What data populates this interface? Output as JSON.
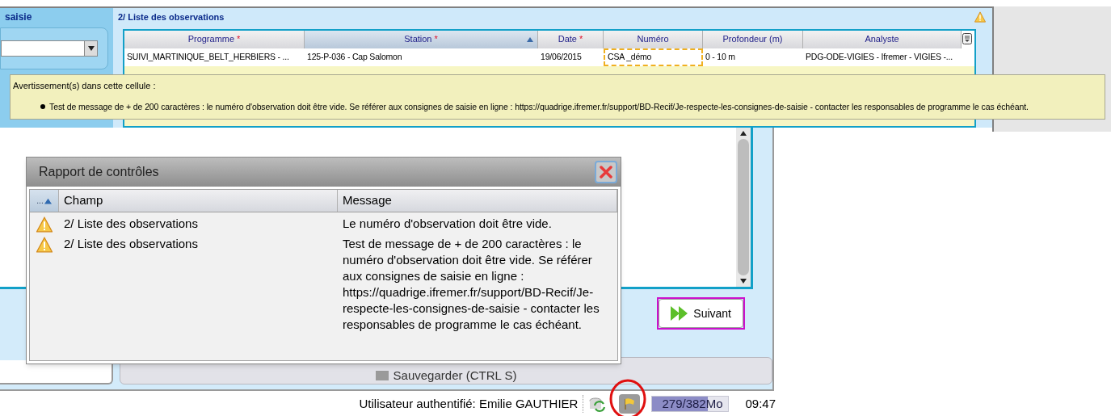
{
  "left_panel": {
    "title": "saisie"
  },
  "observations": {
    "title": "2/ Liste des observations",
    "required_mark": "*",
    "columns": [
      {
        "label": "Programme",
        "required": true,
        "sorted": false
      },
      {
        "label": "Station",
        "required": true,
        "sorted": true
      },
      {
        "label": "Date",
        "required": true,
        "sorted": false
      },
      {
        "label": "Numéro",
        "required": false,
        "sorted": false
      },
      {
        "label": "Profondeur (m)",
        "required": false,
        "sorted": false
      },
      {
        "label": "Analyste",
        "required": false,
        "sorted": false
      }
    ],
    "rows": [
      {
        "cells": [
          {
            "text": "SUIVI_MARTINIQUE_BELT_HERBIERS - ...",
            "warning": false
          },
          {
            "text": "125-P-036 - Cap Salomon",
            "warning": false
          },
          {
            "text": "19/06/2015",
            "warning": false
          },
          {
            "text": "CSA _démo",
            "warning": true
          },
          {
            "text": "0 - 10 m",
            "warning": false
          },
          {
            "text": "PDG-ODE-VIGIES - Ifremer - VIGIES -...",
            "warning": false
          }
        ]
      }
    ]
  },
  "tooltip": {
    "title": "Avertissement(s) dans cette cellule :",
    "items": [
      "Test de message de + de 200 caractères : le numéro d'observation doit être vide. Se référer aux consignes de saisie en ligne : https://quadrige.ifremer.fr/support/BD-Recif/Je-respecte-les-consignes-de-saisie - contacter les responsables de programme le cas échéant."
    ]
  },
  "next_button": "Suivant",
  "save_button": "Sauvegarder (CTRL S)",
  "dialog": {
    "title": "Rapport de contrôles",
    "columns": [
      {
        "label": "...",
        "sorted": true
      },
      {
        "label": "Champ",
        "sorted": false
      },
      {
        "label": "Message",
        "sorted": false
      }
    ],
    "rows": [
      {
        "field": "2/ Liste des observations",
        "message": "Le numéro d'observation doit être vide."
      },
      {
        "field": "2/ Liste des observations",
        "message": "Test de message de + de 200 caractères : le numéro d'observation doit être vide. Se référer aux consignes de saisie en ligne : https://quadrige.ifremer.fr/support/BD-Recif/Je-respecte-les-consignes-de-saisie - contacter les responsables de programme le cas échéant."
      }
    ]
  },
  "status_bar": {
    "user": "Utilisateur authentifié: Emilie GAUTHIER",
    "memory": {
      "reading": "279/382Mo",
      "level": 0.73
    },
    "time": "09:47"
  }
}
